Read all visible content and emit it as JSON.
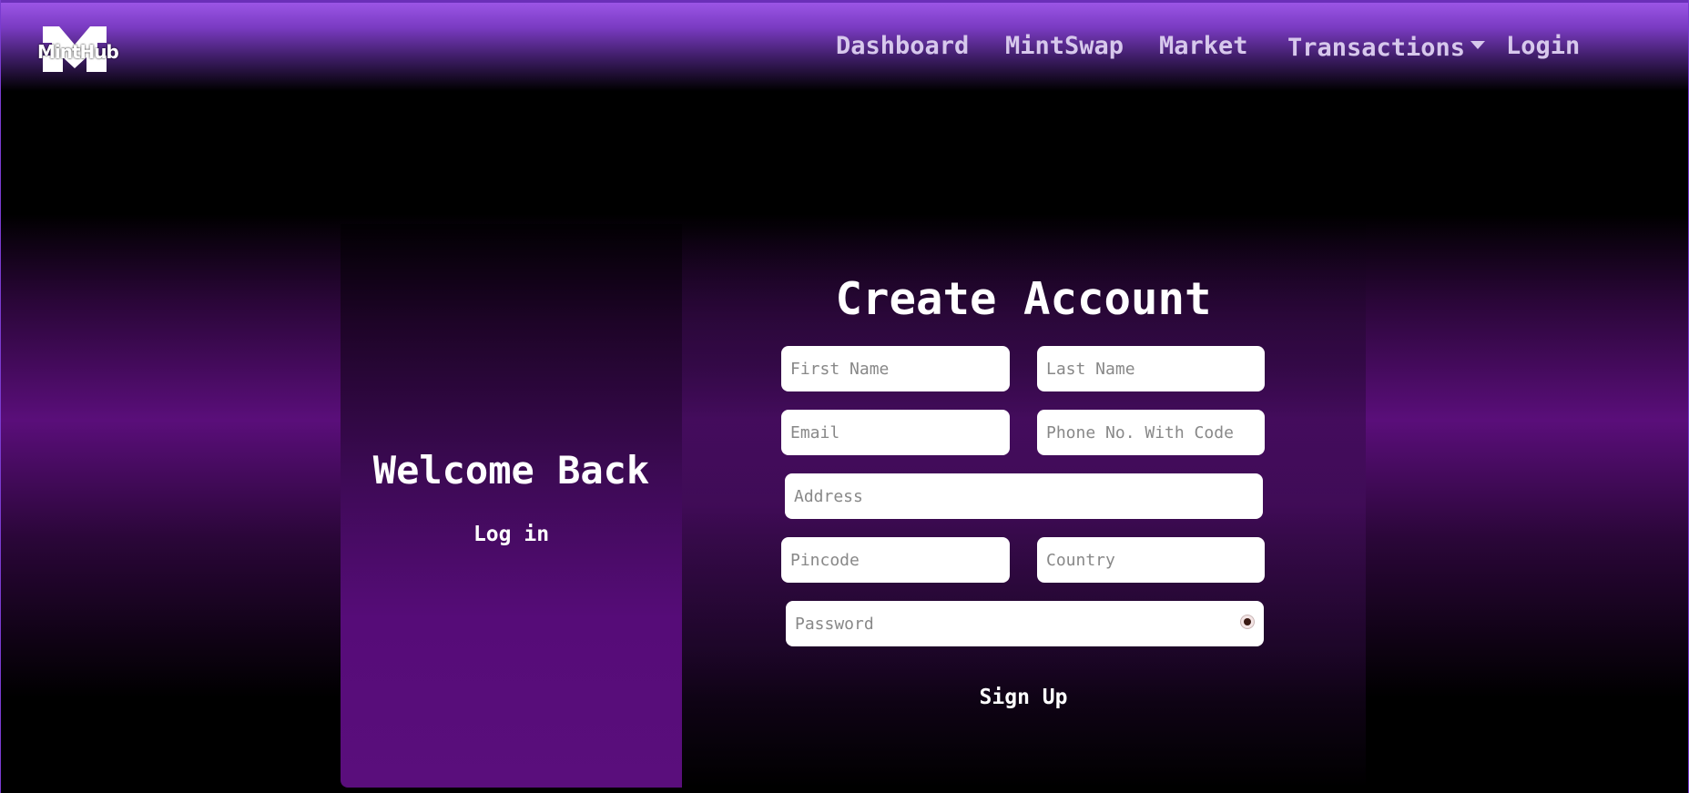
{
  "app": {
    "logo_text": "MintHub"
  },
  "nav": {
    "dashboard": "Dashboard",
    "mintswap": "MintSwap",
    "market": "Market",
    "transactions": "Transactions",
    "login": "Login"
  },
  "overlay": {
    "heading": "Welcome Back",
    "login_label": "Log in"
  },
  "form": {
    "title": "Create Account",
    "first_name": {
      "placeholder": "First Name",
      "value": ""
    },
    "last_name": {
      "placeholder": "Last Name",
      "value": ""
    },
    "email": {
      "placeholder": "Email",
      "value": ""
    },
    "phone": {
      "placeholder": "Phone No. With Code",
      "value": ""
    },
    "address": {
      "placeholder": "Address",
      "value": ""
    },
    "pincode": {
      "placeholder": "Pincode",
      "value": ""
    },
    "country": {
      "placeholder": "Country",
      "value": ""
    },
    "password": {
      "placeholder": "Password",
      "value": ""
    },
    "submit_label": "Sign Up"
  },
  "icons": {
    "logo": "minthub-m-logo",
    "toggle_password": "eye-icon",
    "dropdown": "caret-down-icon"
  },
  "colors": {
    "accent": "#9b55e6",
    "panel": "#5a0e7c",
    "text": "#ffffff"
  }
}
